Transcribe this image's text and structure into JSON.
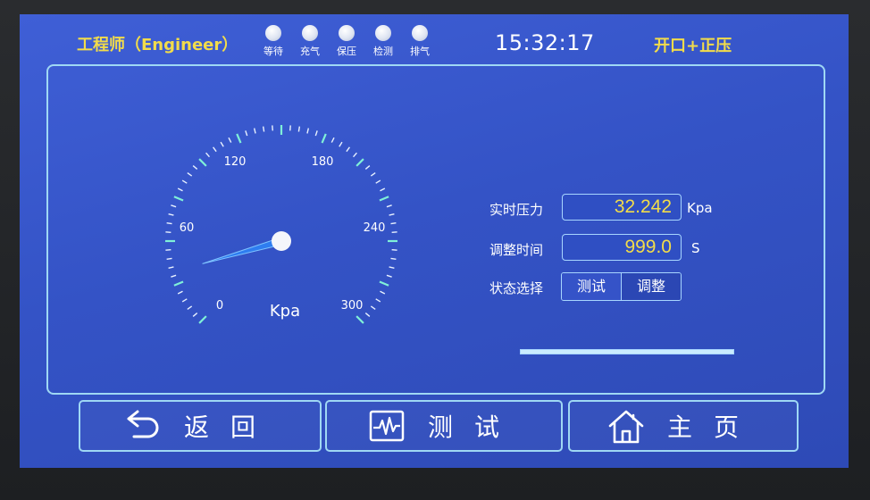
{
  "header": {
    "role": "工程师（Engineer）",
    "clock": "15:32:17",
    "mode": "开口+正压",
    "indicators": [
      {
        "label": "等待"
      },
      {
        "label": "充气"
      },
      {
        "label": "保压"
      },
      {
        "label": "检测"
      },
      {
        "label": "排气"
      }
    ]
  },
  "gauge": {
    "unit": "Kpa",
    "min": 0,
    "max": 300,
    "tick_labels": [
      "0",
      "60",
      "120",
      "180",
      "240",
      "300"
    ],
    "value": 32.242
  },
  "readouts": {
    "pressure": {
      "label": "实时压力",
      "value": "32.242",
      "unit": "Kpa"
    },
    "adjust_time": {
      "label": "调整时间",
      "value": "999.0",
      "unit": "S"
    },
    "state": {
      "label": "状态选择",
      "options": [
        "测试",
        "调整"
      ],
      "selected": "调整"
    }
  },
  "progress": {
    "fraction": 1.0
  },
  "footer": {
    "back_label": "返回",
    "test_label": "测试",
    "home_label": "主页"
  },
  "colors": {
    "screen": "#3453c6",
    "accent_yellow": "#f2dc4a",
    "border_cyan": "#9fd8f4",
    "tick_cyan": "#7ff0d8"
  }
}
